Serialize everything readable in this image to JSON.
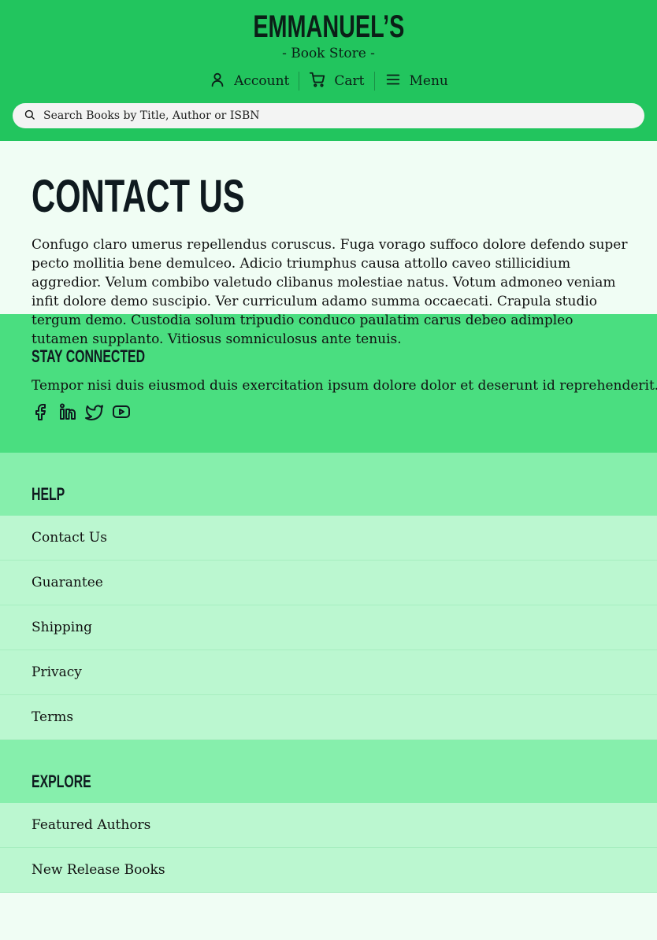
{
  "header": {
    "logo_title": "EMMANUEL’S",
    "logo_subtitle": "- Book Store -",
    "nav": [
      {
        "label": "Account",
        "icon": "user-icon"
      },
      {
        "label": "Cart",
        "icon": "cart-icon"
      },
      {
        "label": "Menu",
        "icon": "hamburger-menu-icon"
      }
    ],
    "search_placeholder": "Search Books by Title, Author or ISBN"
  },
  "contact": {
    "title": "CONTACT US",
    "body": "Confugo claro umerus repellendus coruscus. Fuga vorago suffoco dolore defendo super pecto mollitia bene demulceo. Adicio triumphus causa attollo caveo stillicidium aggredior. Velum combibo valetudo clibanus molestiae natus. Votum admoneo veniam infit dolore demo suscipio. Ver curriculum adamo summa occaecati. Crapula studio tergum demo. Custodia solum tripudio conduco paulatim carus debeo adimpleo tutamen supplanto. Vitiosus somniculosus ante tenuis."
  },
  "stay_connected": {
    "title": "STAY CONNECTED",
    "text": "Tempor nisi duis eiusmod duis exercitation ipsum dolore dolor et deserunt id reprehenderit.",
    "social_icons": [
      "facebook-icon",
      "linkedin-icon",
      "twitter-icon",
      "youtube-icon"
    ]
  },
  "help": {
    "title": "HELP",
    "links": [
      "Contact Us",
      "Guarantee",
      "Shipping",
      "Privacy",
      "Terms"
    ]
  },
  "explore": {
    "title": "EXPLORE",
    "links": [
      "Featured Authors",
      "New Release Books"
    ]
  },
  "colors": {
    "header_bg": "#22c55e",
    "stay_bg": "#4ade80",
    "group_head_bg": "#86efac",
    "link_bg": "#bbf7d0",
    "page_bg": "#f0fdf4"
  }
}
